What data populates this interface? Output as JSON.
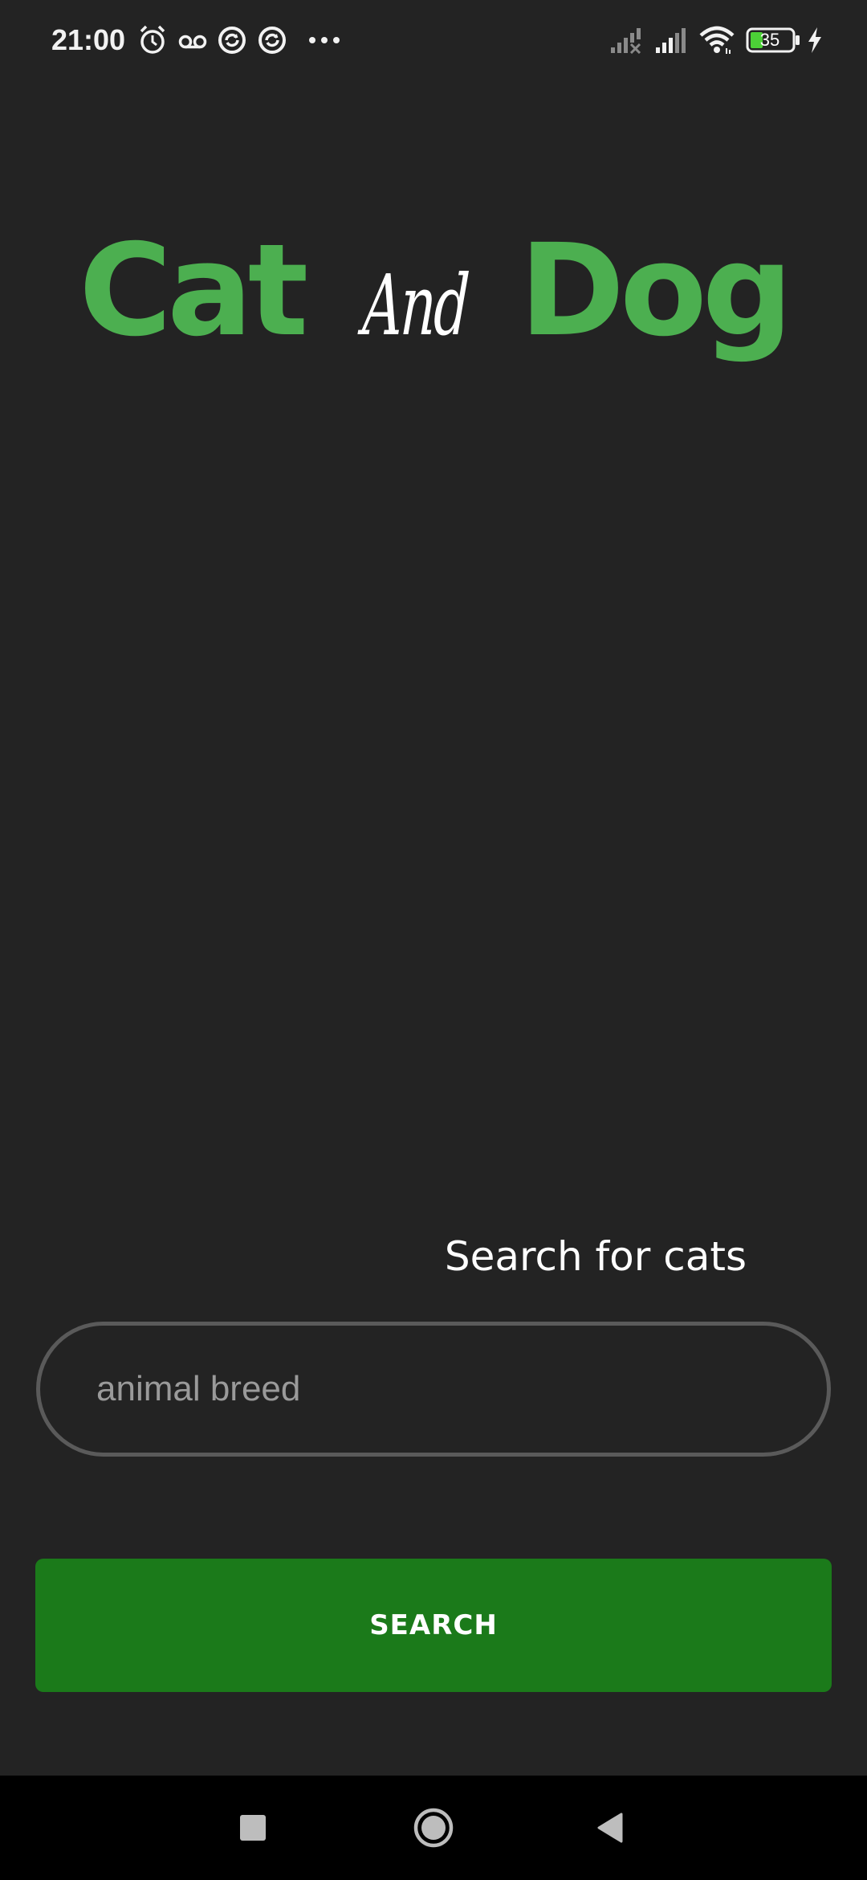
{
  "status_bar": {
    "time": "21:00",
    "left_icons": [
      "alarm-icon",
      "voicemail-icon",
      "sync-icon",
      "sync-icon",
      "more-dots-icon"
    ],
    "right_icons": [
      "signal-no-service-icon",
      "signal-icon",
      "wifi-icon",
      "battery-icon",
      "charging-icon"
    ],
    "battery_level": "35"
  },
  "logo": {
    "word_1": "Cat",
    "word_2": "And",
    "word_3": "Dog",
    "accent_color": "#4caf50"
  },
  "search": {
    "label": "Search for cats",
    "placeholder": "animal breed",
    "value": "",
    "button_label": "SEARCH",
    "button_color": "#1b7a1a"
  },
  "nav_bar": {
    "buttons": [
      "recents-icon",
      "home-icon",
      "back-icon"
    ]
  }
}
